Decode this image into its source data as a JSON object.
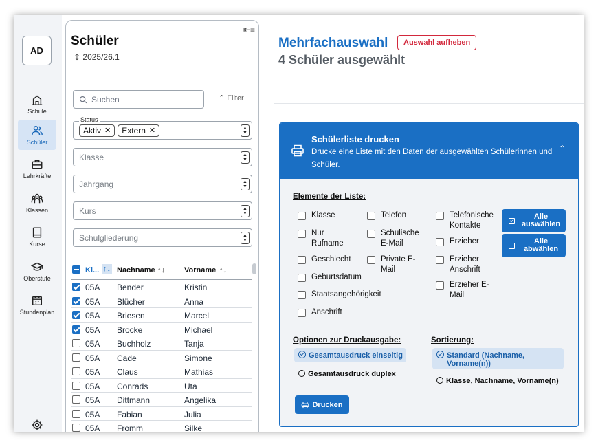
{
  "rail": {
    "avatar": "AD",
    "items": [
      {
        "label": "Schule",
        "icon": "school-icon"
      },
      {
        "label": "Schüler",
        "icon": "students-icon",
        "active": true
      },
      {
        "label": "Lehrkräfte",
        "icon": "briefcase-icon"
      },
      {
        "label": "Klassen",
        "icon": "classes-icon"
      },
      {
        "label": "Kurse",
        "icon": "book-icon"
      },
      {
        "label": "Oberstufe",
        "icon": "graduation-cap-icon"
      },
      {
        "label": "Stundenplan",
        "icon": "calendar-icon"
      }
    ]
  },
  "list": {
    "title": "Schüler",
    "term": "2025/26.1",
    "search_placeholder": "Suchen",
    "filter_label": "Filter",
    "status_label": "Status",
    "status_chips": [
      "Aktiv",
      "Extern"
    ],
    "klasse_placeholder": "Klasse",
    "jahrgang_placeholder": "Jahrgang",
    "kurs_placeholder": "Kurs",
    "schulgliederung_placeholder": "Schulgliederung",
    "columns": {
      "klasse": "Kl...",
      "nachname": "Nachname",
      "vorname": "Vorname"
    },
    "rows": [
      {
        "checked": true,
        "klasse": "05A",
        "nachname": "Bender",
        "vorname": "Kristin"
      },
      {
        "checked": true,
        "klasse": "05A",
        "nachname": "Blücher",
        "vorname": "Anna"
      },
      {
        "checked": true,
        "klasse": "05A",
        "nachname": "Briesen",
        "vorname": "Marcel"
      },
      {
        "checked": true,
        "klasse": "05A",
        "nachname": "Brocke",
        "vorname": "Michael"
      },
      {
        "checked": false,
        "klasse": "05A",
        "nachname": "Buchholz",
        "vorname": "Tanja"
      },
      {
        "checked": false,
        "klasse": "05A",
        "nachname": "Cade",
        "vorname": "Simone"
      },
      {
        "checked": false,
        "klasse": "05A",
        "nachname": "Claus",
        "vorname": "Mathias"
      },
      {
        "checked": false,
        "klasse": "05A",
        "nachname": "Conrads",
        "vorname": "Uta"
      },
      {
        "checked": false,
        "klasse": "05A",
        "nachname": "Dittmann",
        "vorname": "Angelika"
      },
      {
        "checked": false,
        "klasse": "05A",
        "nachname": "Fabian",
        "vorname": "Julia"
      },
      {
        "checked": false,
        "klasse": "05A",
        "nachname": "Fromm",
        "vorname": "Silke"
      }
    ]
  },
  "main": {
    "title": "Mehrfachauswahl",
    "deselect_label": "Auswahl aufheben",
    "subtitle": "4 Schüler ausgewählt",
    "card": {
      "title": "Schülerliste drucken",
      "description": "Drucke eine Liste mit den Daten der ausgewählten Schülerinnen und Schüler.",
      "elements_heading": "Elemente der Liste:",
      "col1": [
        "Klasse",
        "Nur Rufname",
        "Geschlecht",
        "Geburtsdatum",
        "Staatsangehörigkeit",
        "Anschrift"
      ],
      "col2": [
        "Telefon",
        "Schulische E-Mail",
        "Private E-Mail"
      ],
      "col3": [
        "Telefonische Kontakte",
        "Erzieher",
        "Erzieher Anschrift",
        "Erzieher E-Mail"
      ],
      "select_all": "Alle auswählen",
      "deselect_all": "Alle abwählen",
      "print_options_heading": "Optionen zur Druckausgabe:",
      "print_options": [
        "Gesamtausdruck einseitig",
        "Gesamtausdruck duplex"
      ],
      "sort_heading": "Sortierung:",
      "sort_options": [
        "Standard (Nachname, Vorname(n))",
        "Klasse, Nachname, Vorname(n)"
      ],
      "print_button": "Drucken"
    }
  },
  "colors": {
    "accent": "#1a6fc4",
    "danger": "#d2283c"
  }
}
